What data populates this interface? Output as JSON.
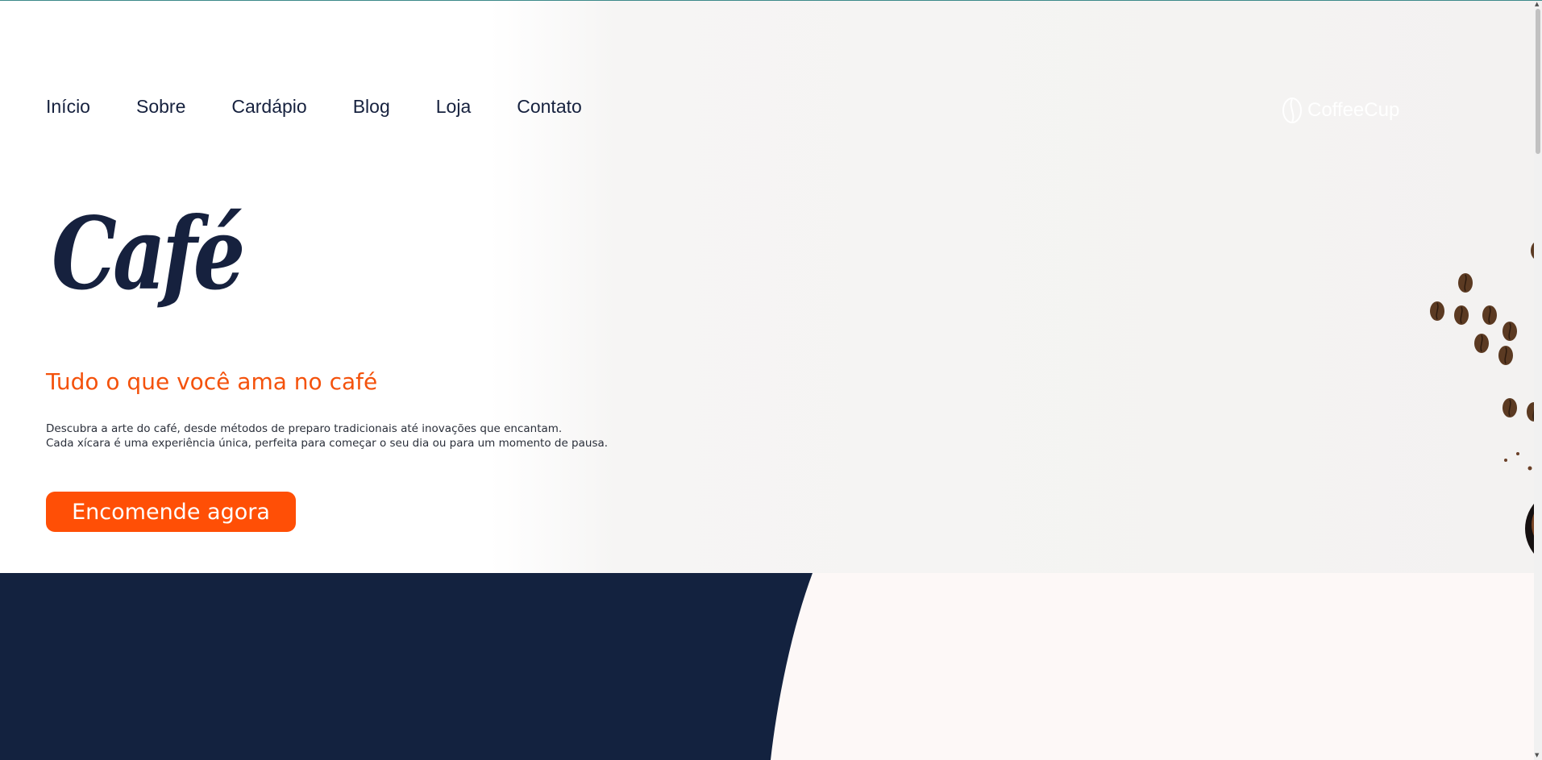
{
  "nav": {
    "items": [
      {
        "label": "Início"
      },
      {
        "label": "Sobre"
      },
      {
        "label": "Cardápio"
      },
      {
        "label": "Blog"
      },
      {
        "label": "Loja"
      },
      {
        "label": "Contato"
      }
    ]
  },
  "brand": {
    "label": "CoffeeCup",
    "icon": "coffee-bean-icon"
  },
  "hero": {
    "title": "Café",
    "subtitle": "Tudo o que você ama no café",
    "description_line1": "Descubra a arte do café, desde métodos de preparo tradicionais até inovações que encantam.",
    "description_line2": "Cada xícara é uma experiência única, perfeita para começar o seu dia ou para um momento de pausa.",
    "cta_label": "Encomende agora"
  },
  "colors": {
    "accent": "#ff4f06",
    "navy": "#13223f",
    "text_dark": "#16213e",
    "lower_bg": "#fdf8f7"
  }
}
